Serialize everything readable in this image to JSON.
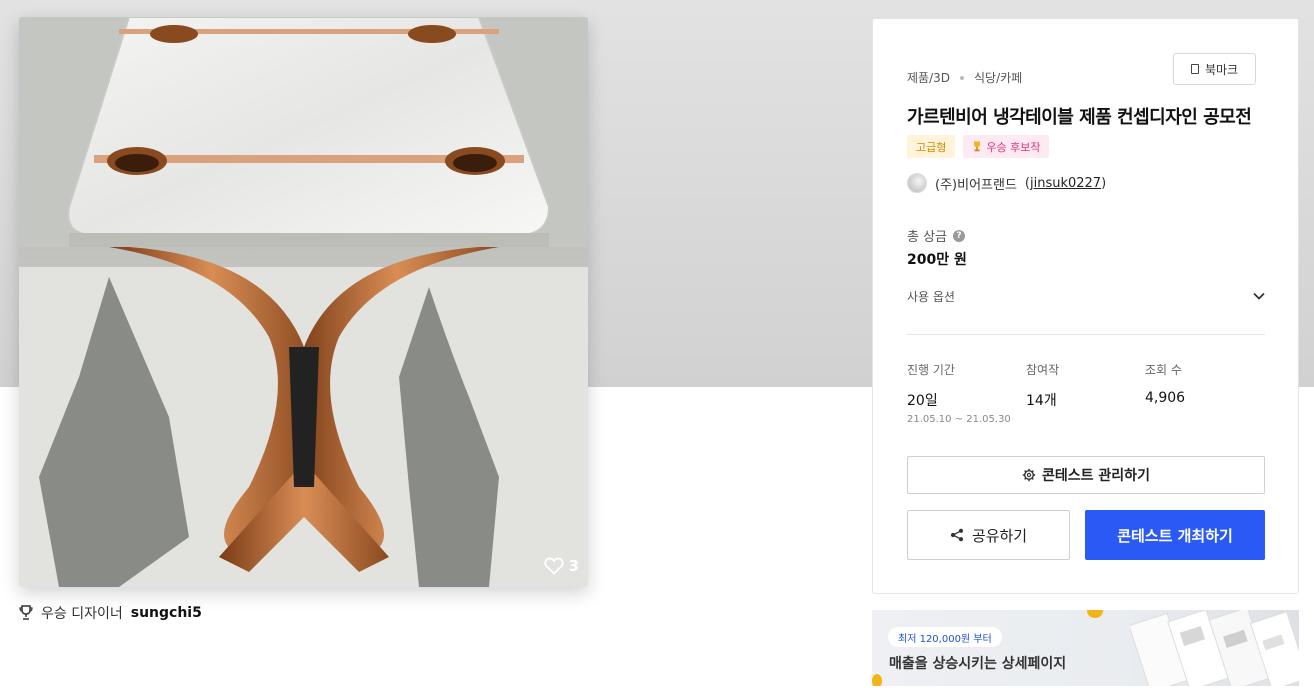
{
  "gallery": {
    "like_count": "3",
    "winner_prefix": "우승 디자이너",
    "winner_name": "sungchi5"
  },
  "contest": {
    "category_main": "제품/3D",
    "category_sub": "식당/카페",
    "bookmark_label": "북마크",
    "title": "가르텐비어 냉각테이블 제품 컨셉디자인 공모전",
    "tags": [
      "고급형",
      "우승 후보작"
    ],
    "host_name": "(주)비어프랜드",
    "host_id": "jinsuk0227",
    "prize_label": "총 상금",
    "prize_value": "200만 원",
    "options_label": "사용 옵션",
    "stats": {
      "period_label": "진행 기간",
      "period_value": "20일",
      "period_range": "21.05.10 ~ 21.05.30",
      "entries_label": "참여작",
      "entries_value": "14개",
      "views_label": "조회 수",
      "views_value": "4,906"
    },
    "manage_label": "콘테스트 관리하기",
    "share_label": "공유하기",
    "host_contest_label": "콘테스트 개최하기"
  },
  "ad": {
    "pill": "최저 120,000원 부터",
    "headline": "매출을 상승시키는 상세페이지"
  },
  "colors": {
    "primary": "#2a59f5",
    "premium_tag": "#d38a00",
    "candidate_tag": "#e0337a"
  }
}
